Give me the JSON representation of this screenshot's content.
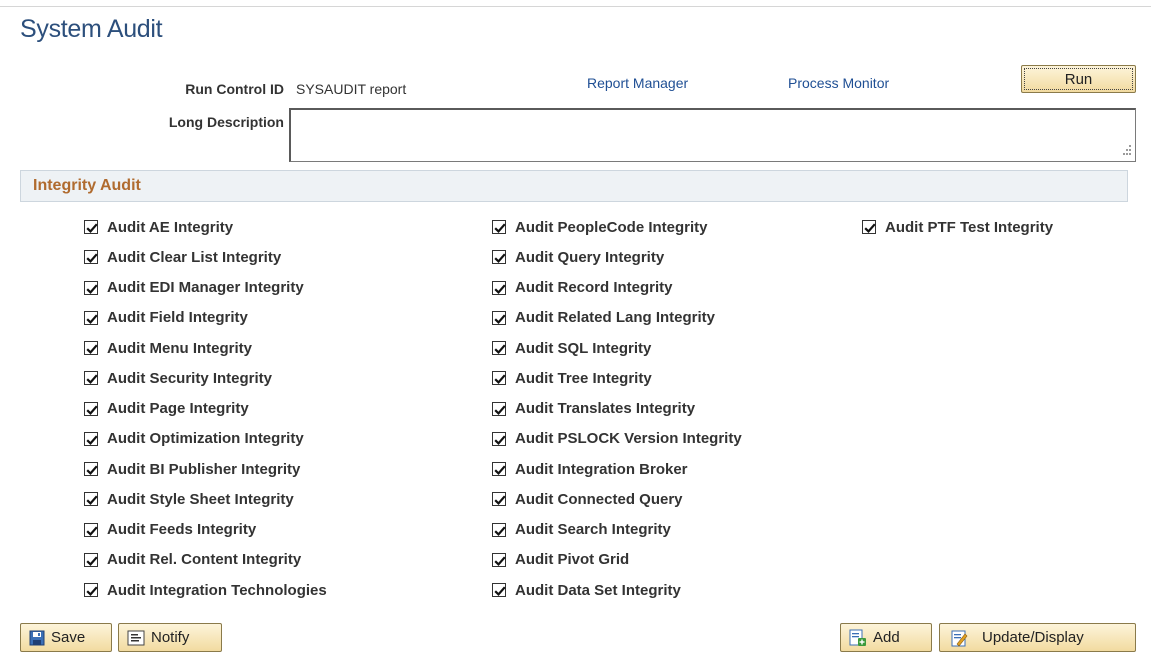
{
  "page": {
    "title": "System Audit"
  },
  "run_control": {
    "label": "Run Control ID",
    "value": "SYSAUDIT report"
  },
  "links": {
    "report_manager": "Report Manager",
    "process_monitor": "Process Monitor"
  },
  "run_button": {
    "label": "Run"
  },
  "long_description": {
    "label": "Long Description",
    "value": ""
  },
  "section": {
    "title": "Integrity Audit"
  },
  "checkbox_columns": [
    [
      {
        "label": "Audit AE Integrity",
        "checked": true
      },
      {
        "label": "Audit Clear List Integrity",
        "checked": true
      },
      {
        "label": "Audit EDI Manager Integrity",
        "checked": true
      },
      {
        "label": "Audit Field Integrity",
        "checked": true
      },
      {
        "label": "Audit Menu Integrity",
        "checked": true
      },
      {
        "label": "Audit Security Integrity",
        "checked": true
      },
      {
        "label": "Audit Page Integrity",
        "checked": true
      },
      {
        "label": "Audit Optimization Integrity",
        "checked": true
      },
      {
        "label": "Audit BI Publisher Integrity",
        "checked": true
      },
      {
        "label": "Audit Style Sheet Integrity",
        "checked": true
      },
      {
        "label": "Audit Feeds Integrity",
        "checked": true
      },
      {
        "label": "Audit Rel. Content Integrity",
        "checked": true
      },
      {
        "label": "Audit Integration Technologies",
        "checked": true
      }
    ],
    [
      {
        "label": "Audit PeopleCode Integrity",
        "checked": true
      },
      {
        "label": "Audit Query Integrity",
        "checked": true
      },
      {
        "label": "Audit Record Integrity",
        "checked": true
      },
      {
        "label": "Audit Related Lang Integrity",
        "checked": true
      },
      {
        "label": "Audit SQL Integrity",
        "checked": true
      },
      {
        "label": "Audit Tree Integrity",
        "checked": true
      },
      {
        "label": "Audit Translates Integrity",
        "checked": true
      },
      {
        "label": "Audit PSLOCK Version Integrity",
        "checked": true
      },
      {
        "label": "Audit Integration Broker",
        "checked": true
      },
      {
        "label": "Audit Connected Query",
        "checked": true
      },
      {
        "label": "Audit Search Integrity",
        "checked": true
      },
      {
        "label": "Audit Pivot Grid",
        "checked": true
      },
      {
        "label": "Audit Data Set Integrity",
        "checked": true
      }
    ],
    [
      {
        "label": "Audit PTF Test Integrity",
        "checked": true
      }
    ]
  ],
  "toolbar": {
    "save": {
      "label": "Save",
      "icon": "save-icon"
    },
    "notify": {
      "label": "Notify",
      "icon": "notify-icon"
    },
    "add": {
      "label": "Add",
      "icon": "add-icon"
    },
    "update_display": {
      "label": "Update/Display",
      "icon": "update-display-icon"
    }
  },
  "colors": {
    "title": "#2c4f7c",
    "link": "#1f4f94",
    "section_title": "#b06b2f",
    "button_bg": "#f2dba0"
  }
}
